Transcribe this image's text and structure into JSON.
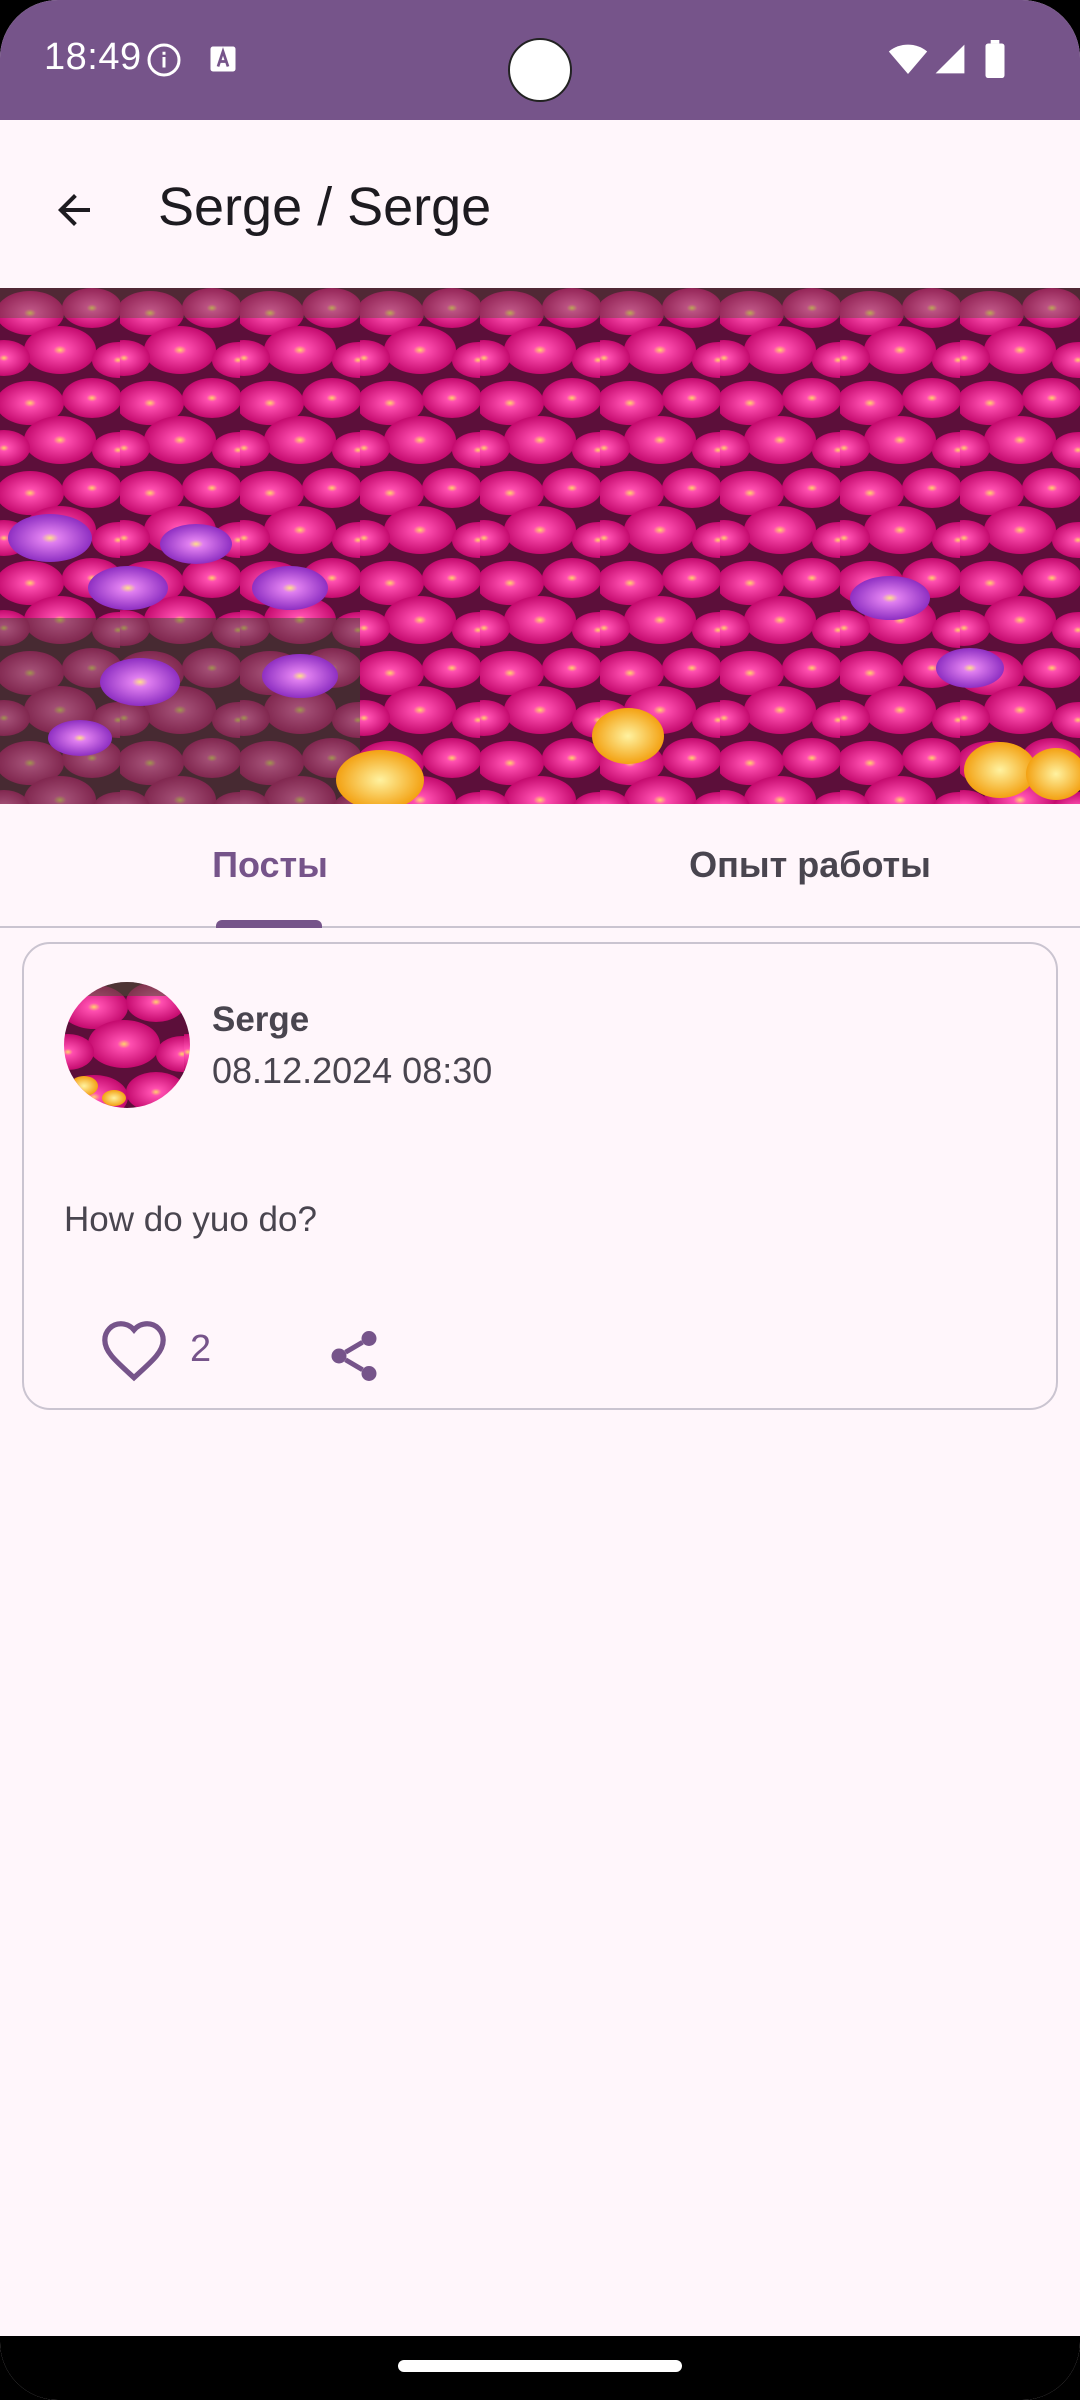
{
  "status_bar": {
    "time": "18:49",
    "background": "#76548A",
    "icons": [
      "info-icon",
      "a-icon",
      "wifi-icon",
      "signal-icon",
      "battery-icon"
    ]
  },
  "app_bar": {
    "title": "Serge / Serge",
    "back_icon": "arrow-back-icon"
  },
  "cover_image": {
    "subject": "pink and magenta ice plant flowers"
  },
  "tabs": [
    {
      "label": "Посты",
      "selected": true
    },
    {
      "label": "Опыт работы",
      "selected": false
    }
  ],
  "posts": [
    {
      "author": "Serge",
      "date": "08.12.2024 08:30",
      "text": "How do yuo do?",
      "likes": "2",
      "like_icon": "heart-outline-icon",
      "share_icon": "share-icon"
    }
  ],
  "colors": {
    "accent": "#76548A",
    "background": "#FFF6FB",
    "text_primary": "#1D1B20",
    "text_secondary": "#49454F",
    "outline": "#CAC4D0"
  }
}
